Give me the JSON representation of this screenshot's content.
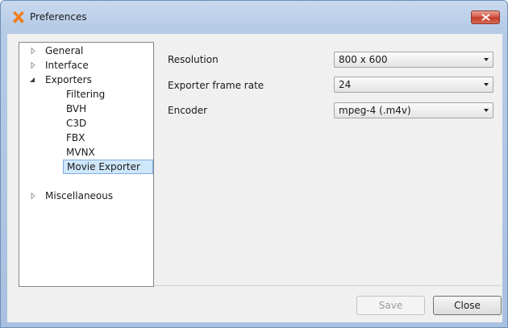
{
  "window": {
    "title": "Preferences"
  },
  "tree": {
    "items": [
      {
        "label": "General",
        "expanded": false
      },
      {
        "label": "Interface",
        "expanded": false
      },
      {
        "label": "Exporters",
        "expanded": true
      },
      {
        "label": "Filtering"
      },
      {
        "label": "BVH"
      },
      {
        "label": "C3D"
      },
      {
        "label": "FBX"
      },
      {
        "label": "MVNX"
      },
      {
        "label": "Movie Exporter",
        "selected": true
      },
      {
        "label": "Miscellaneous",
        "expanded": false
      }
    ]
  },
  "settings": {
    "resolution": {
      "label": "Resolution",
      "value": "800 x 600"
    },
    "frame_rate": {
      "label": "Exporter frame rate",
      "value": "24"
    },
    "encoder": {
      "label": "Encoder",
      "value": "mpeg-4 (.m4v)"
    }
  },
  "buttons": {
    "save": "Save",
    "close": "Close"
  },
  "colors": {
    "titlebar": "#b6cbe6",
    "selection": "#cfe7fb",
    "close_button": "#c9473a"
  }
}
